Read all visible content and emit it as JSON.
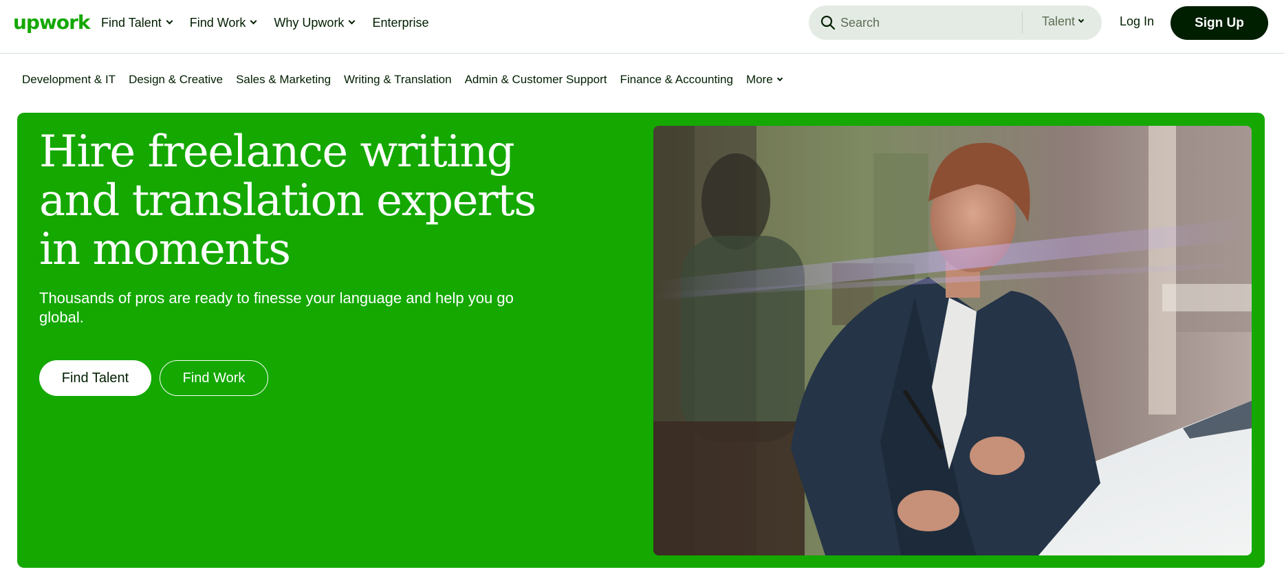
{
  "header": {
    "logo": "upwork",
    "nav": [
      {
        "label": "Find Talent",
        "has_dropdown": true
      },
      {
        "label": "Find Work",
        "has_dropdown": true
      },
      {
        "label": "Why Upwork",
        "has_dropdown": true
      },
      {
        "label": "Enterprise",
        "has_dropdown": false
      }
    ],
    "search": {
      "placeholder": "Search",
      "type_selected": "Talent"
    },
    "login_label": "Log In",
    "signup_label": "Sign Up"
  },
  "categories": [
    "Development & IT",
    "Design & Creative",
    "Sales & Marketing",
    "Writing & Translation",
    "Admin & Customer Support",
    "Finance & Accounting",
    "More"
  ],
  "hero": {
    "title_lines": [
      "Hire freelance writing",
      "and translation experts",
      "in moments"
    ],
    "subtitle": "Thousands of pros are ready to finesse your language and help you go global.",
    "primary_button": "Find Talent",
    "secondary_button": "Find Work"
  },
  "colors": {
    "brand_green": "#14a800",
    "dark": "#001e00",
    "search_bg": "#e4ebe4"
  },
  "icons": {
    "search": "search-icon",
    "dropdown": "chevron-down-icon"
  }
}
